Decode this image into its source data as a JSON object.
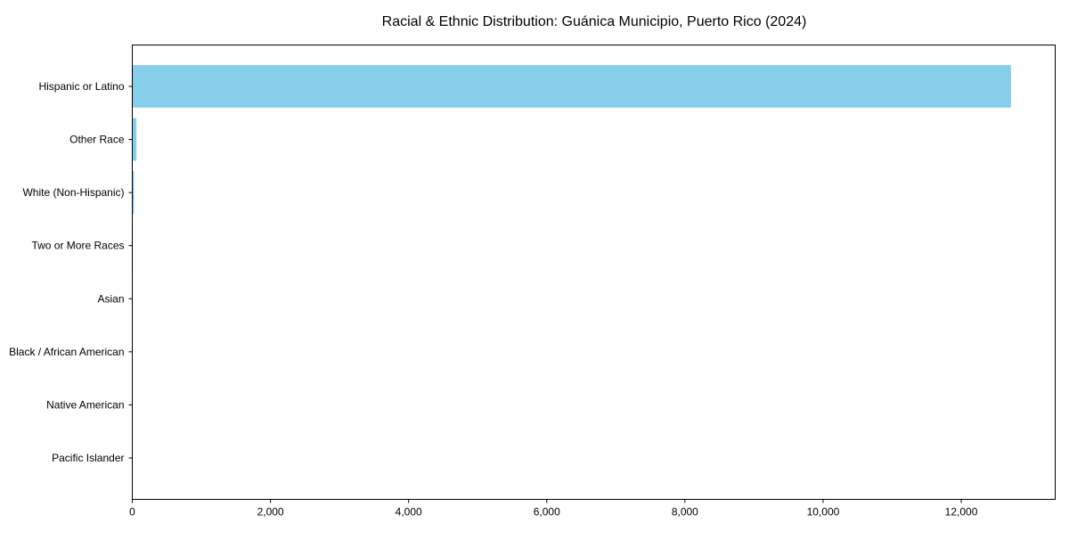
{
  "chart_data": {
    "type": "bar",
    "orientation": "horizontal",
    "title": "Racial & Ethnic Distribution: Guánica Municipio, Puerto Rico (2024)",
    "xlabel": "",
    "ylabel": "",
    "categories": [
      "Hispanic or Latino",
      "Other Race",
      "White (Non-Hispanic)",
      "Two or More Races",
      "Asian",
      "Black / African American",
      "Native American",
      "Pacific Islander"
    ],
    "values": [
      12720,
      60,
      25,
      8,
      2,
      1,
      3,
      2
    ],
    "xlim": [
      0,
      13360
    ],
    "xticks": [
      0,
      2000,
      4000,
      6000,
      8000,
      10000,
      12000
    ],
    "xtick_labels": [
      "0",
      "2,000",
      "4,000",
      "6,000",
      "8,000",
      "10,000",
      "12,000"
    ],
    "grid": false,
    "bar_color": "#87CEEB"
  }
}
